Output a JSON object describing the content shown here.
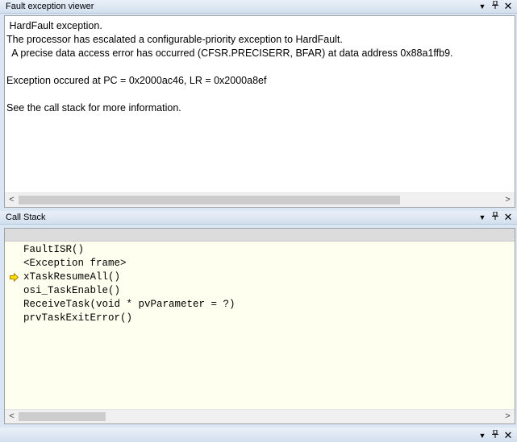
{
  "fault_viewer": {
    "title": "Fault exception viewer",
    "lines": [
      " HardFault exception.",
      "The processor has escalated a configurable-priority exception to HardFault.",
      "  A precise data access error has occurred (CFSR.PRECISERR, BFAR) at data address 0x88a1ffb9.",
      "",
      "Exception occured at PC = 0x2000ac46, LR = 0x2000a8ef",
      "",
      "See the call stack for more information."
    ]
  },
  "call_stack": {
    "title": "Call Stack",
    "frames": [
      {
        "label": "FaultISR()"
      },
      {
        "label": "<Exception frame>"
      },
      {
        "label": "xTaskResumeAll()",
        "current": true
      },
      {
        "label": "osi_TaskEnable()"
      },
      {
        "label": "ReceiveTask(void * pvParameter = ?)"
      },
      {
        "label": "prvTaskExitError()"
      }
    ]
  },
  "title_buttons": {
    "dropdown": "▼",
    "pin": "📌",
    "close": "✕"
  },
  "icons": {
    "current_frame": "yellow-arrow-icon"
  },
  "colors": {
    "arrow_fill": "#ffe000",
    "arrow_stroke": "#b08000",
    "call_bg": "#ffffef"
  }
}
